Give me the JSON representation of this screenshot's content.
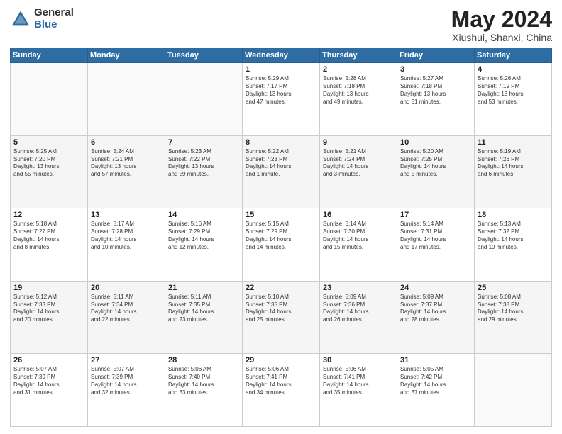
{
  "header": {
    "logo_general": "General",
    "logo_blue": "Blue",
    "title": "May 2024",
    "location": "Xiushui, Shanxi, China"
  },
  "weekdays": [
    "Sunday",
    "Monday",
    "Tuesday",
    "Wednesday",
    "Thursday",
    "Friday",
    "Saturday"
  ],
  "weeks": [
    [
      {
        "day": "",
        "info": ""
      },
      {
        "day": "",
        "info": ""
      },
      {
        "day": "",
        "info": ""
      },
      {
        "day": "1",
        "info": "Sunrise: 5:29 AM\nSunset: 7:17 PM\nDaylight: 13 hours\nand 47 minutes."
      },
      {
        "day": "2",
        "info": "Sunrise: 5:28 AM\nSunset: 7:18 PM\nDaylight: 13 hours\nand 49 minutes."
      },
      {
        "day": "3",
        "info": "Sunrise: 5:27 AM\nSunset: 7:18 PM\nDaylight: 13 hours\nand 51 minutes."
      },
      {
        "day": "4",
        "info": "Sunrise: 5:26 AM\nSunset: 7:19 PM\nDaylight: 13 hours\nand 53 minutes."
      }
    ],
    [
      {
        "day": "5",
        "info": "Sunrise: 5:25 AM\nSunset: 7:20 PM\nDaylight: 13 hours\nand 55 minutes."
      },
      {
        "day": "6",
        "info": "Sunrise: 5:24 AM\nSunset: 7:21 PM\nDaylight: 13 hours\nand 57 minutes."
      },
      {
        "day": "7",
        "info": "Sunrise: 5:23 AM\nSunset: 7:22 PM\nDaylight: 13 hours\nand 59 minutes."
      },
      {
        "day": "8",
        "info": "Sunrise: 5:22 AM\nSunset: 7:23 PM\nDaylight: 14 hours\nand 1 minute."
      },
      {
        "day": "9",
        "info": "Sunrise: 5:21 AM\nSunset: 7:24 PM\nDaylight: 14 hours\nand 3 minutes."
      },
      {
        "day": "10",
        "info": "Sunrise: 5:20 AM\nSunset: 7:25 PM\nDaylight: 14 hours\nand 5 minutes."
      },
      {
        "day": "11",
        "info": "Sunrise: 5:19 AM\nSunset: 7:26 PM\nDaylight: 14 hours\nand 6 minutes."
      }
    ],
    [
      {
        "day": "12",
        "info": "Sunrise: 5:18 AM\nSunset: 7:27 PM\nDaylight: 14 hours\nand 8 minutes."
      },
      {
        "day": "13",
        "info": "Sunrise: 5:17 AM\nSunset: 7:28 PM\nDaylight: 14 hours\nand 10 minutes."
      },
      {
        "day": "14",
        "info": "Sunrise: 5:16 AM\nSunset: 7:29 PM\nDaylight: 14 hours\nand 12 minutes."
      },
      {
        "day": "15",
        "info": "Sunrise: 5:15 AM\nSunset: 7:29 PM\nDaylight: 14 hours\nand 14 minutes."
      },
      {
        "day": "16",
        "info": "Sunrise: 5:14 AM\nSunset: 7:30 PM\nDaylight: 14 hours\nand 15 minutes."
      },
      {
        "day": "17",
        "info": "Sunrise: 5:14 AM\nSunset: 7:31 PM\nDaylight: 14 hours\nand 17 minutes."
      },
      {
        "day": "18",
        "info": "Sunrise: 5:13 AM\nSunset: 7:32 PM\nDaylight: 14 hours\nand 19 minutes."
      }
    ],
    [
      {
        "day": "19",
        "info": "Sunrise: 5:12 AM\nSunset: 7:33 PM\nDaylight: 14 hours\nand 20 minutes."
      },
      {
        "day": "20",
        "info": "Sunrise: 5:11 AM\nSunset: 7:34 PM\nDaylight: 14 hours\nand 22 minutes."
      },
      {
        "day": "21",
        "info": "Sunrise: 5:11 AM\nSunset: 7:35 PM\nDaylight: 14 hours\nand 23 minutes."
      },
      {
        "day": "22",
        "info": "Sunrise: 5:10 AM\nSunset: 7:35 PM\nDaylight: 14 hours\nand 25 minutes."
      },
      {
        "day": "23",
        "info": "Sunrise: 5:09 AM\nSunset: 7:36 PM\nDaylight: 14 hours\nand 26 minutes."
      },
      {
        "day": "24",
        "info": "Sunrise: 5:09 AM\nSunset: 7:37 PM\nDaylight: 14 hours\nand 28 minutes."
      },
      {
        "day": "25",
        "info": "Sunrise: 5:08 AM\nSunset: 7:38 PM\nDaylight: 14 hours\nand 29 minutes."
      }
    ],
    [
      {
        "day": "26",
        "info": "Sunrise: 5:07 AM\nSunset: 7:39 PM\nDaylight: 14 hours\nand 31 minutes."
      },
      {
        "day": "27",
        "info": "Sunrise: 5:07 AM\nSunset: 7:39 PM\nDaylight: 14 hours\nand 32 minutes."
      },
      {
        "day": "28",
        "info": "Sunrise: 5:06 AM\nSunset: 7:40 PM\nDaylight: 14 hours\nand 33 minutes."
      },
      {
        "day": "29",
        "info": "Sunrise: 5:06 AM\nSunset: 7:41 PM\nDaylight: 14 hours\nand 34 minutes."
      },
      {
        "day": "30",
        "info": "Sunrise: 5:06 AM\nSunset: 7:41 PM\nDaylight: 14 hours\nand 35 minutes."
      },
      {
        "day": "31",
        "info": "Sunrise: 5:05 AM\nSunset: 7:42 PM\nDaylight: 14 hours\nand 37 minutes."
      },
      {
        "day": "",
        "info": ""
      }
    ]
  ]
}
